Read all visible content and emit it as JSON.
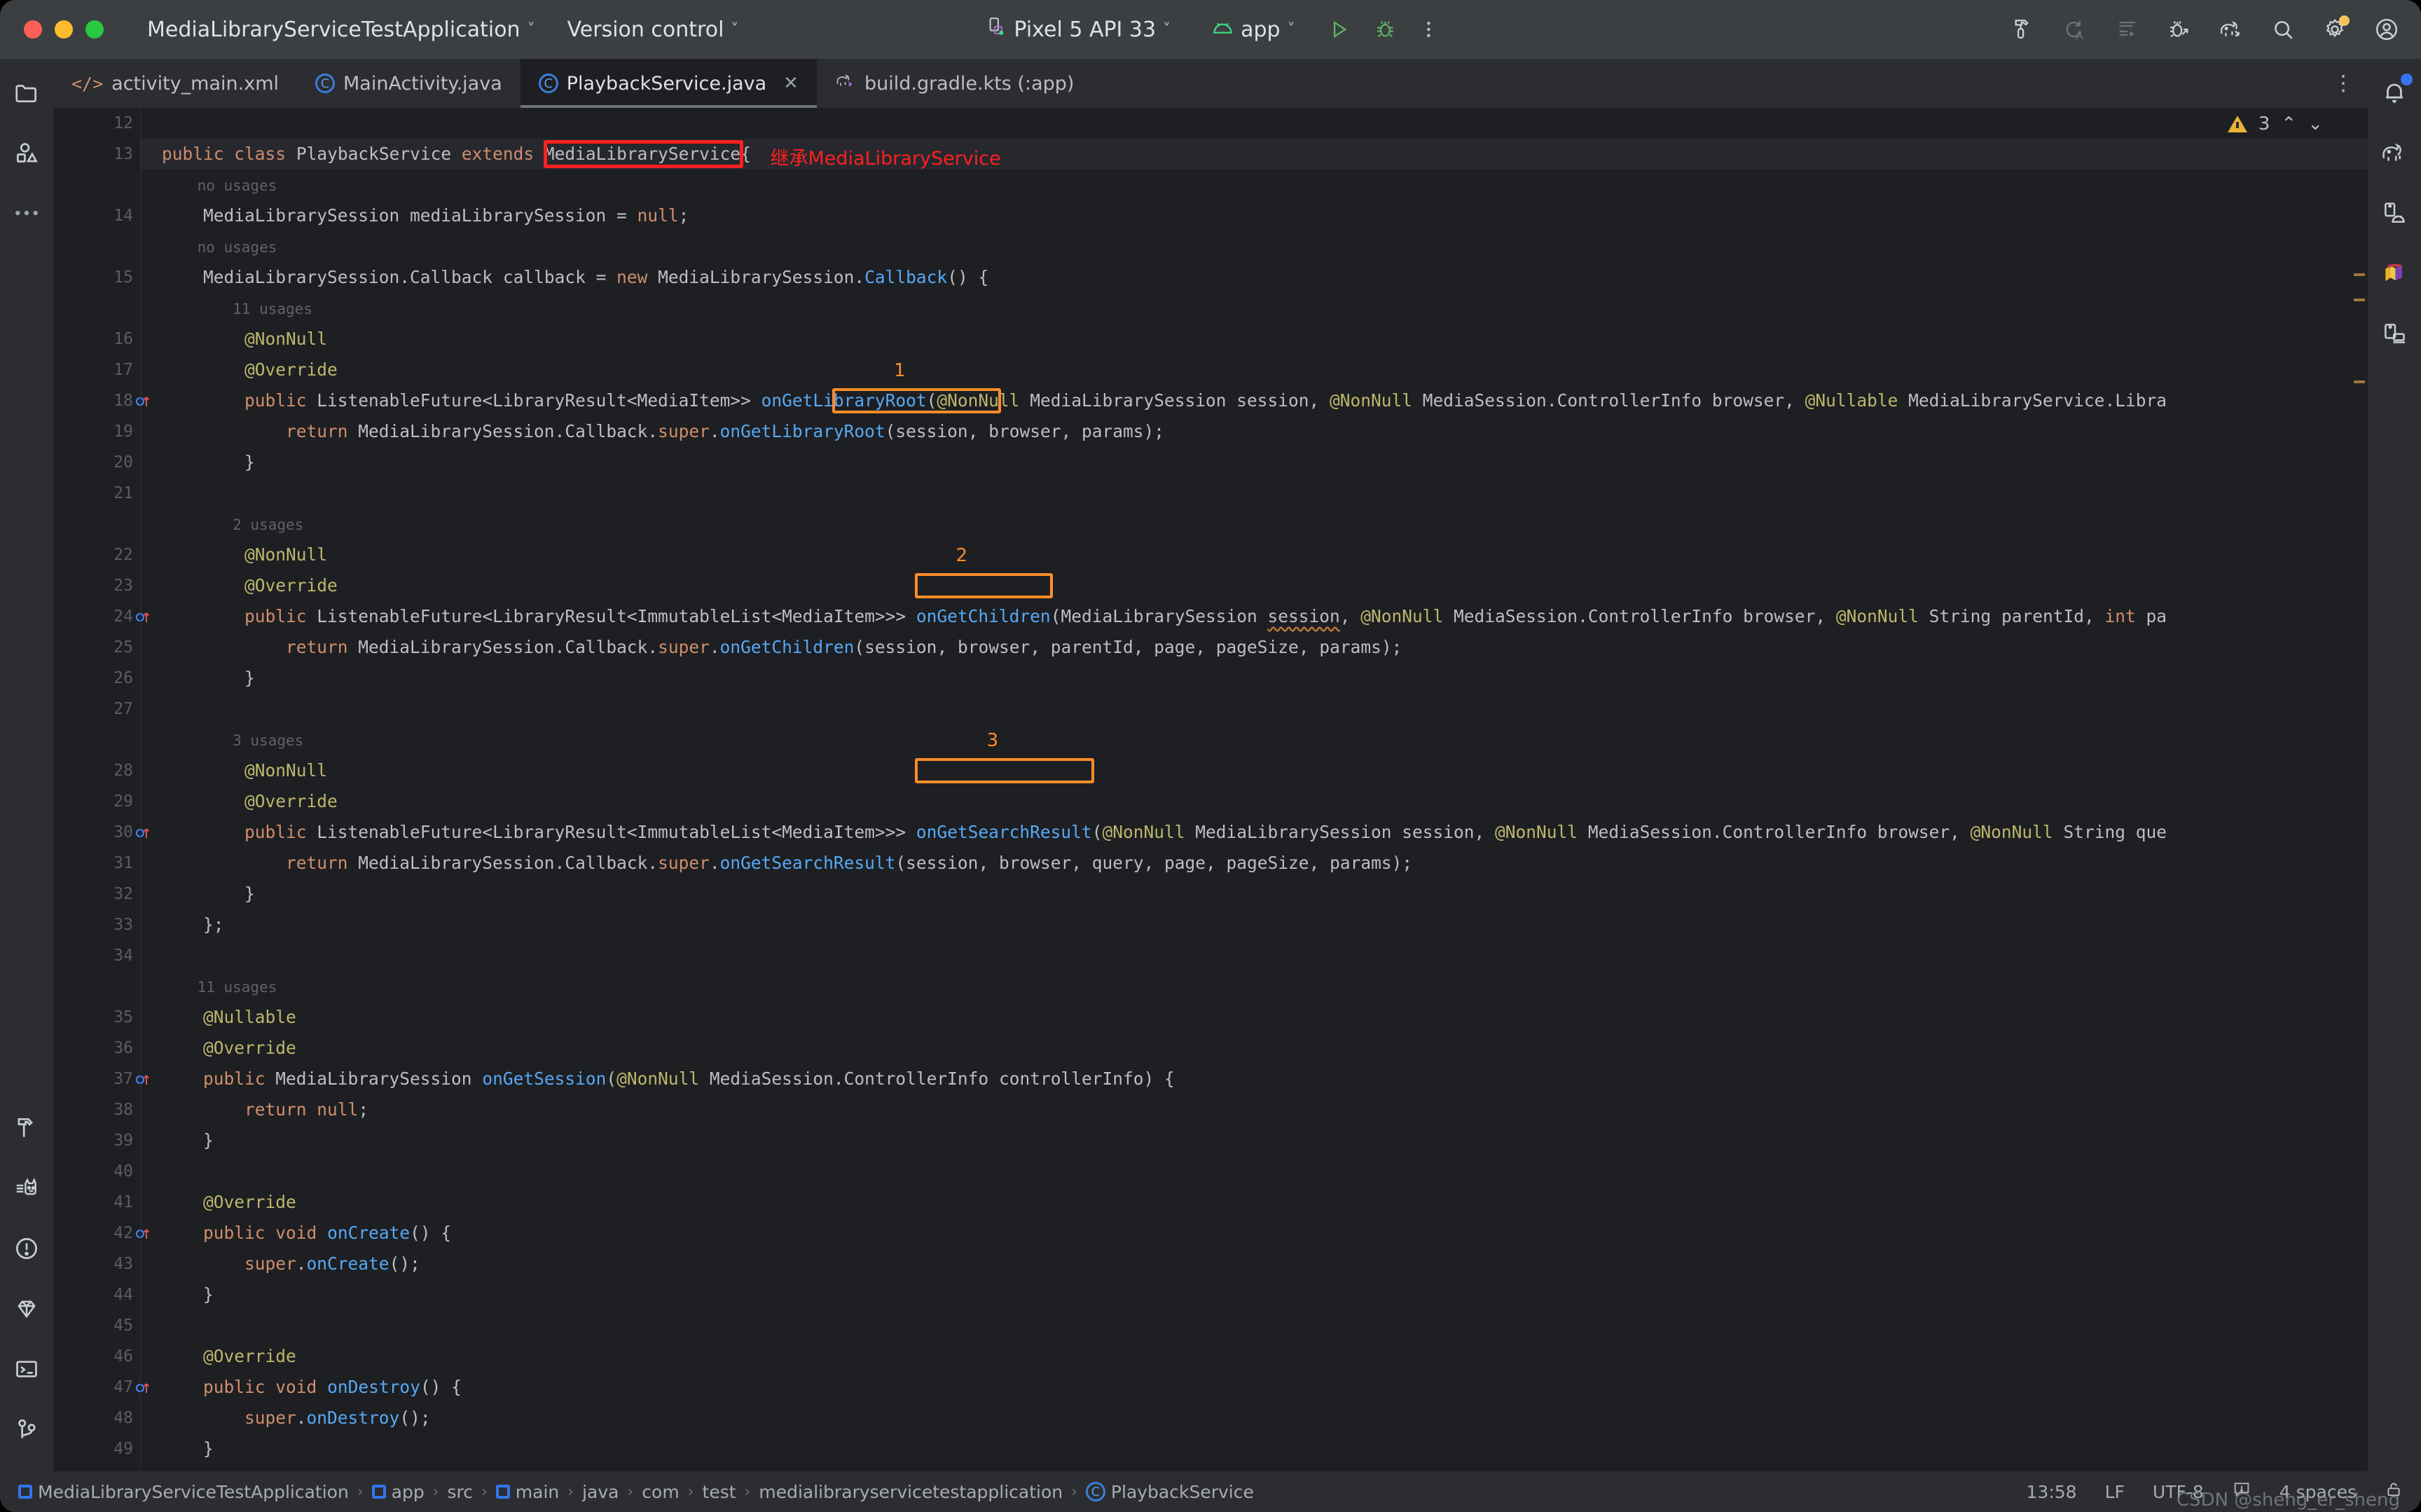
{
  "window": {
    "project_title": "MediaLibraryServiceTestApplication",
    "vcs_label": "Version control",
    "device_label": "Pixel 5 API 33",
    "run_config_label": "app",
    "traffic_lights": [
      "close-button",
      "minimize-button",
      "maximize-button"
    ]
  },
  "toolbar_right": {
    "icons": [
      {
        "name": "build-hammer-icon",
        "glyph": "hammer"
      },
      {
        "name": "redo-icon",
        "glyph": "redo-a"
      },
      {
        "name": "format-lines-icon",
        "glyph": "lines"
      },
      {
        "name": "debug-attach-icon",
        "glyph": "bug-arrow"
      },
      {
        "name": "gradle-sync-icon",
        "glyph": "elephant-arrow"
      },
      {
        "name": "search-icon",
        "glyph": "magnifier"
      },
      {
        "name": "settings-gear-icon",
        "glyph": "gear",
        "badge": true
      },
      {
        "name": "account-avatar-icon",
        "glyph": "avatar"
      }
    ]
  },
  "left_rail": {
    "top_icons": [
      {
        "name": "project-folder-icon"
      },
      {
        "name": "resource-manager-icon"
      },
      {
        "name": "more-tool-windows-icon"
      }
    ],
    "bottom_icons": [
      {
        "name": "build-hammer-icon"
      },
      {
        "name": "logcat-cat-icon"
      },
      {
        "name": "problems-icon"
      },
      {
        "name": "app-quality-gem-icon"
      },
      {
        "name": "terminal-icon"
      },
      {
        "name": "version-control-branch-icon"
      }
    ]
  },
  "right_rail": {
    "icons": [
      {
        "name": "notifications-bell-icon",
        "badge": true
      },
      {
        "name": "gradle-elephant-icon"
      },
      {
        "name": "device-manager-icon"
      },
      {
        "name": "app-inspection-icon"
      },
      {
        "name": "running-devices-icon"
      }
    ]
  },
  "tabs": [
    {
      "label": "activity_main.xml",
      "icon": "xml-file-icon",
      "active": false,
      "closable": false
    },
    {
      "label": "MainActivity.java",
      "icon": "java-class-icon",
      "active": false,
      "closable": false
    },
    {
      "label": "PlaybackService.java",
      "icon": "java-class-icon",
      "active": true,
      "closable": true
    },
    {
      "label": "build.gradle.kts (:app)",
      "icon": "gradle-file-icon",
      "active": false,
      "closable": false
    }
  ],
  "editor": {
    "inspection_warning_count": "3",
    "lines": [
      {
        "n": "12",
        "text": "",
        "hl": false
      },
      {
        "n": "13",
        "text": "public class PlaybackService extends MediaLibraryService{",
        "hl": true
      },
      {
        "n": "",
        "text": "    no usages",
        "hint": true
      },
      {
        "n": "14",
        "text": "    MediaLibrarySession mediaLibrarySession = null;"
      },
      {
        "n": "",
        "text": "    no usages",
        "hint": true
      },
      {
        "n": "15",
        "text": "    MediaLibrarySession.Callback callback = new MediaLibrarySession.Callback() {"
      },
      {
        "n": "",
        "text": "        11 usages",
        "hint": true
      },
      {
        "n": "16",
        "text": "        @NonNull"
      },
      {
        "n": "17",
        "text": "        @Override"
      },
      {
        "n": "18",
        "text": "        public ListenableFuture<LibraryResult<MediaItem>> onGetLibraryRoot(@NonNull MediaLibrarySession session, @NonNull MediaSession.ControllerInfo browser, @Nullable MediaLibraryService.Libra",
        "marker": "override"
      },
      {
        "n": "19",
        "text": "            return MediaLibrarySession.Callback.super.onGetLibraryRoot(session, browser, params);"
      },
      {
        "n": "20",
        "text": "        }"
      },
      {
        "n": "21",
        "text": ""
      },
      {
        "n": "",
        "text": "        2 usages",
        "hint": true
      },
      {
        "n": "22",
        "text": "        @NonNull"
      },
      {
        "n": "23",
        "text": "        @Override"
      },
      {
        "n": "24",
        "text": "        public ListenableFuture<LibraryResult<ImmutableList<MediaItem>>> onGetChildren(MediaLibrarySession session, @NonNull MediaSession.ControllerInfo browser, @NonNull String parentId, int pa",
        "marker": "override"
      },
      {
        "n": "25",
        "text": "            return MediaLibrarySession.Callback.super.onGetChildren(session, browser, parentId, page, pageSize, params);"
      },
      {
        "n": "26",
        "text": "        }"
      },
      {
        "n": "27",
        "text": ""
      },
      {
        "n": "",
        "text": "        3 usages",
        "hint": true
      },
      {
        "n": "28",
        "text": "        @NonNull"
      },
      {
        "n": "29",
        "text": "        @Override"
      },
      {
        "n": "30",
        "text": "        public ListenableFuture<LibraryResult<ImmutableList<MediaItem>>> onGetSearchResult(@NonNull MediaLibrarySession session, @NonNull MediaSession.ControllerInfo browser, @NonNull String que",
        "marker": "override"
      },
      {
        "n": "31",
        "text": "            return MediaLibrarySession.Callback.super.onGetSearchResult(session, browser, query, page, pageSize, params);"
      },
      {
        "n": "32",
        "text": "        }"
      },
      {
        "n": "33",
        "text": "    };"
      },
      {
        "n": "34",
        "text": ""
      },
      {
        "n": "",
        "text": "    11 usages",
        "hint": true
      },
      {
        "n": "35",
        "text": "    @Nullable"
      },
      {
        "n": "36",
        "text": "    @Override"
      },
      {
        "n": "37",
        "text": "    public MediaLibrarySession onGetSession(@NonNull MediaSession.ControllerInfo controllerInfo) {",
        "marker": "override"
      },
      {
        "n": "38",
        "text": "        return null;"
      },
      {
        "n": "39",
        "text": "    }"
      },
      {
        "n": "40",
        "text": ""
      },
      {
        "n": "41",
        "text": "    @Override"
      },
      {
        "n": "42",
        "text": "    public void onCreate() {",
        "marker": "override"
      },
      {
        "n": "43",
        "text": "        super.onCreate();"
      },
      {
        "n": "44",
        "text": "    }"
      },
      {
        "n": "45",
        "text": ""
      },
      {
        "n": "46",
        "text": "    @Override"
      },
      {
        "n": "47",
        "text": "    public void onDestroy() {",
        "marker": "override"
      },
      {
        "n": "48",
        "text": "        super.onDestroy();"
      },
      {
        "n": "49",
        "text": "    }"
      }
    ],
    "annotations": [
      {
        "name": "red-box-superclass",
        "label": "继承MediaLibraryService",
        "color": "#ff2020"
      },
      {
        "name": "orange-box-1",
        "label": "1",
        "target": "onGetLibraryRoot",
        "color": "#ff8c2b"
      },
      {
        "name": "orange-box-2",
        "label": "2",
        "target": "onGetChildren",
        "color": "#ff8c2b"
      },
      {
        "name": "orange-box-3",
        "label": "3",
        "target": "onGetSearchResult",
        "color": "#ff8c2b"
      }
    ]
  },
  "statusbar": {
    "breadcrumbs": [
      {
        "label": "MediaLibraryServiceTestApplication",
        "icon": "module-icon"
      },
      {
        "label": "app",
        "icon": "module-icon"
      },
      {
        "label": "src",
        "icon": null
      },
      {
        "label": "main",
        "icon": "module-icon"
      },
      {
        "label": "java",
        "icon": null
      },
      {
        "label": "com",
        "icon": null
      },
      {
        "label": "test",
        "icon": null
      },
      {
        "label": "medialibraryservicetestapplication",
        "icon": null
      },
      {
        "label": "PlaybackService",
        "icon": "java-class-icon"
      }
    ],
    "time": "13:58",
    "line_separator": "LF",
    "encoding": "UTF-8",
    "indent": "4 spaces",
    "notification_icon": "event-log-icon",
    "lock_icon": "read-only-lock-icon",
    "watermark": "CSDN @sheng_er_sheng"
  },
  "colors": {
    "accent_orange": "#ff8c2b",
    "accent_red": "#ff2020",
    "editor_bg": "#1e1f22",
    "chrome_bg": "#2b2d30",
    "titlebar_bg": "#3c3f41",
    "keyword": "#cf8e6d",
    "annotation": "#bcb76c",
    "method": "#56a8f5",
    "run_green": "#5fb865"
  }
}
